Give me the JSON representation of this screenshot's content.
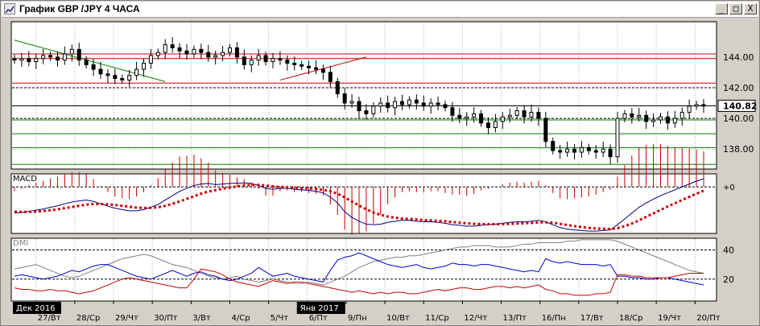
{
  "window": {
    "title": "График GBP /JPY  4 ЧАСА",
    "buttons": {
      "minimize": "_",
      "maximize": "□",
      "close": "X"
    }
  },
  "colors": {
    "background": "#ffffff",
    "candles": "#000000",
    "resistance": "#cc0000",
    "support": "#008000",
    "trendline_down": "#008000",
    "trendline_up": "#cc0000",
    "macd_line": "#000080",
    "macd_signal": "#cc0000",
    "macd_hist": "#cc0000",
    "dmi_adx": "#808080",
    "dmi_plus": "#0000cc",
    "dmi_minus": "#cc0000"
  },
  "chart_data": [
    {
      "type": "candlestick",
      "panel": "price",
      "ylim": [
        136.7,
        146.3
      ],
      "yticks": [
        138,
        140,
        142,
        144
      ],
      "last_price_label": "140.82",
      "last_price": 140.82,
      "x_labels": [
        "27/Вт",
        "28/Ср",
        "29/Чт",
        "30/Пт",
        "3/Вт",
        "4/Ср",
        "5/Чт",
        "6/Пт",
        "9/Пн",
        "10/Вт",
        "11/Ср",
        "12/Чт",
        "13/Пт",
        "16/Пн",
        "17/Вт",
        "18/Ср",
        "19/Чт",
        "20/Пт"
      ],
      "period_labels": [
        "Дек 2016",
        "Янв 2017"
      ],
      "close": [
        143.8,
        143.9,
        143.7,
        143.9,
        144.1,
        144.0,
        143.8,
        144.2,
        144.5,
        143.8,
        143.5,
        143.2,
        142.9,
        142.8,
        142.6,
        142.5,
        142.8,
        143.2,
        143.6,
        144.1,
        144.3,
        144.8,
        144.6,
        144.4,
        144.2,
        144.5,
        144.3,
        144.0,
        144.1,
        144.3,
        144.6,
        144.0,
        143.5,
        143.8,
        144.1,
        143.7,
        143.9,
        143.8,
        143.6,
        143.5,
        143.4,
        143.3,
        143.2,
        143.0,
        142.4,
        141.6,
        141.0,
        141.1,
        140.5,
        140.3,
        140.8,
        141.0,
        140.7,
        141.1,
        140.9,
        141.2,
        141.0,
        140.8,
        141.0,
        140.9,
        140.7,
        140.2,
        140.0,
        140.1,
        140.3,
        139.7,
        139.4,
        139.8,
        140.1,
        140.2,
        140.5,
        140.1,
        140.4,
        140.0,
        138.5,
        137.9,
        137.8,
        138.0,
        137.8,
        138.1,
        137.9,
        137.8,
        138.0,
        137.5,
        140.0,
        140.3,
        140.1,
        140.2,
        139.8,
        139.9,
        140.1,
        139.7,
        140.0,
        140.4,
        140.8,
        140.9,
        140.8
      ],
      "xlabel": "",
      "ylabel": "",
      "grid": true,
      "levels_red": [
        144.2,
        143.9,
        142.3
      ],
      "levels_black_dashed": [
        142.0,
        140.0
      ],
      "levels_green": [
        139.9,
        139.0,
        138.1,
        137.0
      ],
      "trendline_down": [
        [
          0,
          145.1
        ],
        [
          21,
          142.4
        ]
      ],
      "trendline_up": [
        [
          37,
          142.5
        ],
        [
          49,
          144.0
        ]
      ]
    },
    {
      "type": "line",
      "panel": "macd",
      "title": "MACD",
      "yticks": [
        "+0"
      ],
      "ylim": [
        -1.6,
        0.45
      ],
      "series": [
        {
          "values": [
            -0.9,
            -0.88,
            -0.84,
            -0.8,
            -0.76,
            -0.7,
            -0.65,
            -0.58,
            -0.52,
            -0.48,
            -0.45,
            -0.5,
            -0.58,
            -0.66,
            -0.73,
            -0.78,
            -0.82,
            -0.82,
            -0.78,
            -0.7,
            -0.6,
            -0.45,
            -0.3,
            -0.15,
            -0.05,
            0.05,
            0.1,
            0.12,
            0.08,
            0.1,
            0.12,
            0.13,
            0.14,
            0.12,
            0.05,
            -0.05,
            -0.08,
            -0.05,
            -0.05,
            -0.08,
            -0.1,
            -0.12,
            -0.15,
            -0.2,
            -0.35,
            -0.55,
            -0.85,
            -1.05,
            -1.18,
            -1.28,
            -1.3,
            -1.28,
            -1.22,
            -1.18,
            -1.15,
            -1.15,
            -1.18,
            -1.2,
            -1.2,
            -1.22,
            -1.25,
            -1.3,
            -1.32,
            -1.35,
            -1.35,
            -1.32,
            -1.3,
            -1.28,
            -1.25,
            -1.22,
            -1.2,
            -1.2,
            -1.18,
            -1.15,
            -1.2,
            -1.3,
            -1.4,
            -1.45,
            -1.48,
            -1.5,
            -1.52,
            -1.52,
            -1.5,
            -1.48,
            -1.3,
            -1.1,
            -0.9,
            -0.7,
            -0.55,
            -0.42,
            -0.3,
            -0.2,
            -0.1,
            0.0,
            0.1,
            0.2,
            0.28
          ]
        },
        {
          "values": [
            -0.85,
            -0.86,
            -0.86,
            -0.85,
            -0.83,
            -0.8,
            -0.77,
            -0.73,
            -0.69,
            -0.65,
            -0.61,
            -0.59,
            -0.59,
            -0.6,
            -0.62,
            -0.65,
            -0.68,
            -0.71,
            -0.72,
            -0.72,
            -0.7,
            -0.65,
            -0.58,
            -0.5,
            -0.41,
            -0.32,
            -0.23,
            -0.16,
            -0.11,
            -0.06,
            -0.02,
            0.02,
            0.05,
            0.07,
            0.07,
            0.05,
            0.02,
            0.0,
            -0.01,
            -0.02,
            -0.04,
            -0.05,
            -0.07,
            -0.1,
            -0.15,
            -0.23,
            -0.36,
            -0.5,
            -0.64,
            -0.77,
            -0.88,
            -0.96,
            -1.02,
            -1.06,
            -1.09,
            -1.1,
            -1.12,
            -1.14,
            -1.15,
            -1.17,
            -1.18,
            -1.21,
            -1.23,
            -1.25,
            -1.27,
            -1.28,
            -1.28,
            -1.28,
            -1.28,
            -1.27,
            -1.26,
            -1.25,
            -1.24,
            -1.22,
            -1.22,
            -1.23,
            -1.27,
            -1.31,
            -1.35,
            -1.38,
            -1.41,
            -1.43,
            -1.44,
            -1.45,
            -1.42,
            -1.35,
            -1.26,
            -1.15,
            -1.03,
            -0.91,
            -0.79,
            -0.67,
            -0.56,
            -0.45,
            -0.34,
            -0.23,
            -0.13
          ]
        }
      ]
    },
    {
      "type": "line",
      "panel": "dmi",
      "title": "DMI",
      "yticks": [
        20,
        40
      ],
      "ylim": [
        5,
        48
      ],
      "series": [
        {
          "values": [
            27,
            28,
            29,
            30,
            28,
            26,
            24,
            22,
            21,
            22,
            24,
            26,
            28,
            30,
            32,
            34,
            35,
            36,
            37,
            36,
            34,
            32,
            30,
            29,
            28,
            26,
            24,
            22,
            21,
            20,
            21,
            22,
            20,
            19,
            18,
            19,
            20,
            19,
            18,
            17,
            17,
            18,
            17,
            16,
            18,
            20,
            22,
            25,
            28,
            30,
            32,
            33,
            34,
            35,
            35,
            36,
            36,
            37,
            38,
            39,
            40,
            41,
            42,
            42,
            43,
            43,
            43,
            42,
            42,
            42,
            43,
            44,
            44,
            45,
            45,
            45,
            45,
            46,
            46,
            47,
            47,
            47,
            47,
            47,
            46,
            44,
            42,
            40,
            38,
            36,
            34,
            32,
            30,
            28,
            26,
            25,
            24
          ]
        },
        {
          "values": [
            22,
            23,
            22,
            21,
            20,
            21,
            22,
            24,
            26,
            25,
            27,
            29,
            30,
            30,
            28,
            26,
            24,
            22,
            21,
            20,
            22,
            24,
            26,
            24,
            22,
            24,
            25,
            23,
            22,
            20,
            19,
            20,
            22,
            24,
            28,
            25,
            22,
            23,
            24,
            22,
            21,
            20,
            19,
            18,
            26,
            33,
            35,
            36,
            38,
            36,
            34,
            32,
            30,
            29,
            28,
            29,
            30,
            28,
            27,
            28,
            29,
            31,
            30,
            30,
            29,
            30,
            30,
            29,
            28,
            27,
            26,
            25,
            26,
            25,
            34,
            32,
            31,
            32,
            31,
            30,
            30,
            30,
            29,
            30,
            22,
            22,
            21,
            21,
            20,
            20,
            21,
            21,
            20,
            19,
            18,
            17,
            16
          ]
        },
        {
          "values": [
            14,
            13,
            13,
            12,
            12,
            13,
            12,
            12,
            11,
            10,
            11,
            12,
            14,
            16,
            18,
            20,
            21,
            20,
            19,
            18,
            17,
            16,
            15,
            14,
            14,
            20,
            27,
            26,
            25,
            23,
            20,
            18,
            17,
            16,
            15,
            17,
            19,
            18,
            17,
            18,
            18,
            17,
            16,
            15,
            14,
            13,
            12,
            11,
            12,
            11,
            10,
            11,
            10,
            11,
            11,
            10,
            10,
            11,
            12,
            13,
            12,
            13,
            14,
            14,
            13,
            13,
            14,
            15,
            15,
            14,
            15,
            14,
            15,
            16,
            13,
            12,
            10,
            10,
            9,
            9,
            9,
            10,
            10,
            11,
            23,
            23,
            22,
            22,
            21,
            21,
            21,
            21,
            22,
            23,
            24,
            24,
            24
          ]
        }
      ]
    }
  ]
}
